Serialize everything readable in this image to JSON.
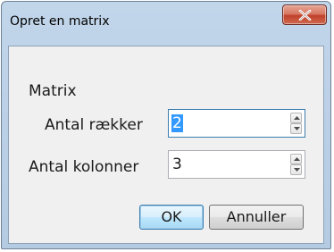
{
  "window": {
    "title": "Opret en matrix"
  },
  "form": {
    "group_label": "Matrix",
    "rows": {
      "label": "Antal rækker",
      "value": "2",
      "value_selected": true
    },
    "columns": {
      "label": "Antal kolonner",
      "value": "3"
    }
  },
  "buttons": {
    "ok_label": "OK",
    "cancel_label": "Annuller"
  },
  "icons": {
    "close": "close-icon",
    "spin_up": "arrow-up-icon",
    "spin_down": "arrow-down-icon"
  },
  "colors": {
    "selection": "#3399ff",
    "close_button": "#c7503a",
    "focus_border": "#3c7fb1"
  }
}
